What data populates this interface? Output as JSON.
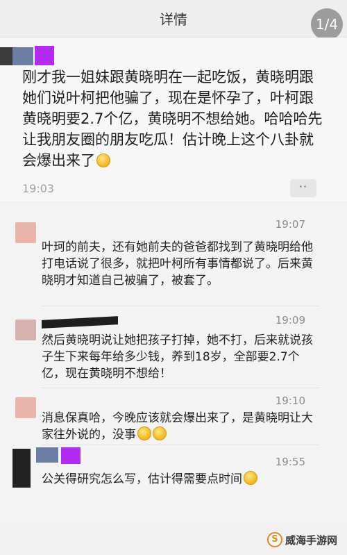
{
  "header": {
    "title": "详情",
    "page_indicator": "1/4"
  },
  "post": {
    "text": "刚才我一姐妹跟黄晓明在一起吃饭，黄晓明跟她们说叶柯把他骗了，现在是怀孕了，叶柯跟黄晓明要2.7个亿，黄晓明不想给她。哈哈哈先让我朋友圈的朋友吃瓜！估计晚上这个八卦就会爆出来了",
    "time": "19:03",
    "more_label": "··"
  },
  "comments": [
    {
      "time": "19:07",
      "text": "叶珂的前夫，还有她前夫的爸爸都找到了黄晓明给他打电话说了很多，就把叶柯所有事情都说了。后来黄晓明才知道自己被骗了，被套了。",
      "avatar_color": "#e9b4aa"
    },
    {
      "time": "19:09",
      "text": "然后黄晓明说让她把孩子打掉，她不打，后来就说孩子生下来每年给多少钱，养到18岁，全部要2.7个亿，现在黄晓明不想给！",
      "avatar_color": "#d7b3b0"
    },
    {
      "time": "19:10",
      "text": "消息保真哈，今晚应该就会爆出来了，是黄晓明让大家往外说的，没事",
      "avatar_color": "#e9b4aa"
    },
    {
      "time": "19:55",
      "text": "公关得研究怎么写，估计得需要点时间",
      "avatar_color": "#222222"
    }
  ],
  "watermark": {
    "text": "威海手游网",
    "logo_glyph": "S"
  },
  "colors": {
    "header_bg": "#eeeeee",
    "post_bg": "#f7f7f7",
    "comment_bg": "#f3f3f3",
    "time_gray": "#a0a0a0",
    "purple_accent": "#b12bf3",
    "blue_gray_accent": "#6d7ea5"
  }
}
